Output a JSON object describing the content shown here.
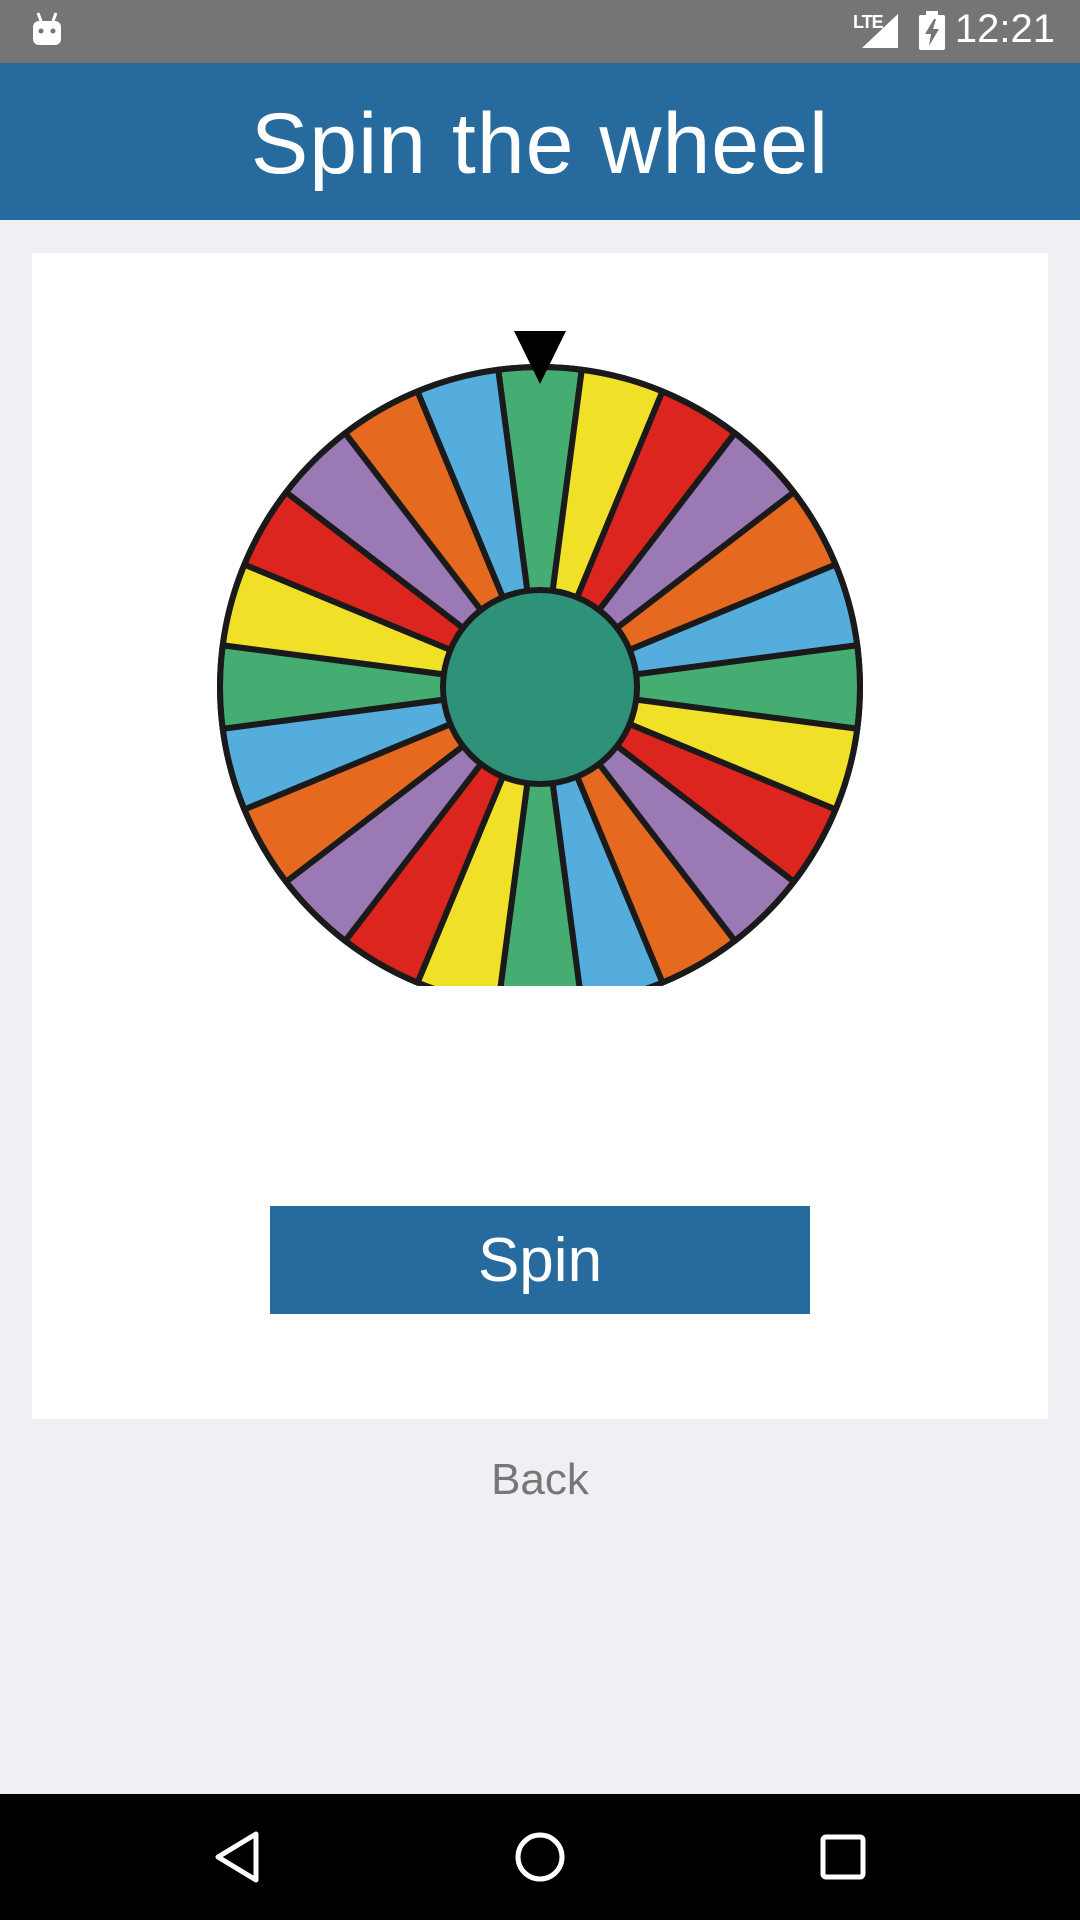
{
  "status_bar": {
    "time": "12:21",
    "network_label": "LTE",
    "icons": [
      "android-icon",
      "lte-signal-icon",
      "battery-charging-icon"
    ]
  },
  "app_bar": {
    "title": "Spin the wheel",
    "color": "#276b9e"
  },
  "wheel": {
    "segment_count": 24,
    "segment_colors": [
      "#45ad72",
      "#f0e027",
      "#dd2520",
      "#9a79b5",
      "#e66920",
      "#55adde"
    ],
    "hub_color": "#2d9278",
    "outline_color": "#1a1a1a",
    "pointer_color": "#000000"
  },
  "actions": {
    "spin_label": "Spin",
    "back_label": "Back"
  },
  "nav_bar": {
    "icons": [
      "back-triangle-icon",
      "home-circle-icon",
      "recents-square-icon"
    ]
  }
}
